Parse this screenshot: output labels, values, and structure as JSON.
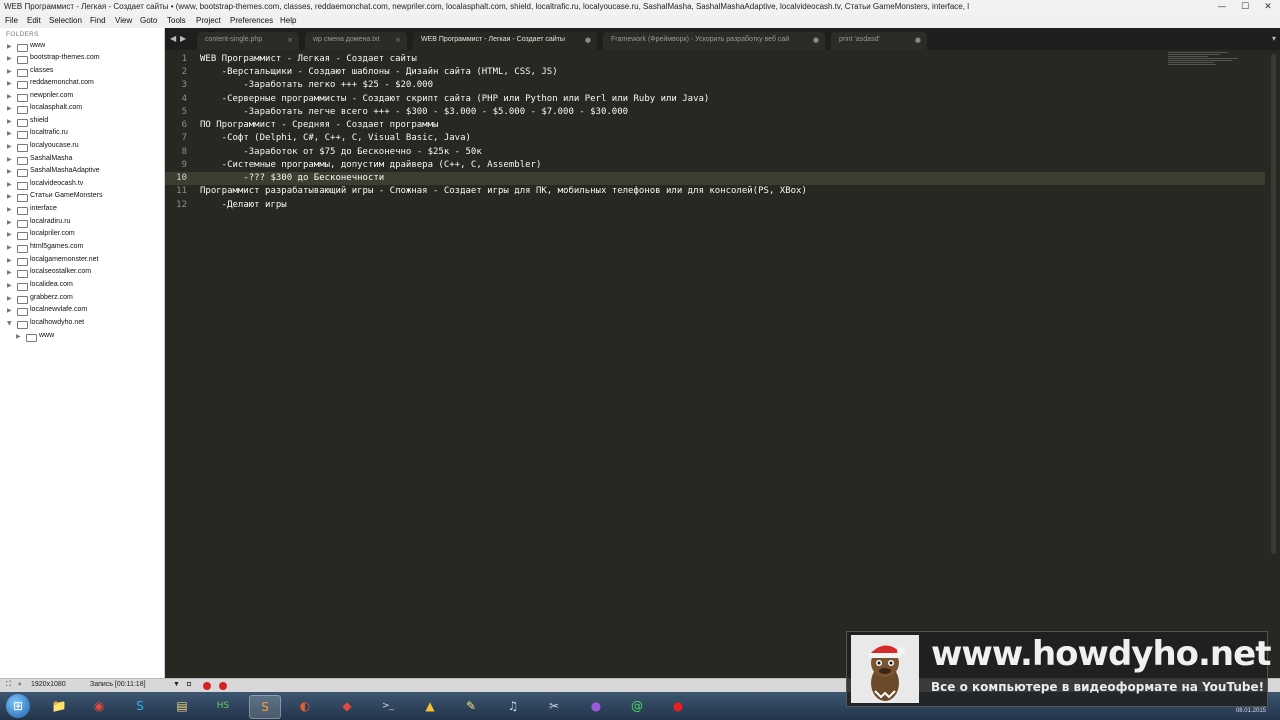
{
  "window": {
    "title": "WEB Программист - Легкая - Создает сайты • (www, bootstrap-themes.com, classes, reddaemonchat.com, newpriler.com, localasphalt.com, shield, localtrafic.ru, localyoucase.ru, SashalMasha, SashalMashaAdaptive, localvideocash.tv, Статьи GameMonsters, interface, l"
  },
  "menu": [
    "File",
    "Edit",
    "Selection",
    "Find",
    "View",
    "Goto",
    "Tools",
    "Project",
    "Preferences",
    "Help"
  ],
  "sidebar": {
    "header": "FOLDERS",
    "items": [
      {
        "label": "www"
      },
      {
        "label": "bootstrap-themes.com"
      },
      {
        "label": "classes"
      },
      {
        "label": "reddaemonchat.com"
      },
      {
        "label": "newpriler.com"
      },
      {
        "label": "localasphalt.com"
      },
      {
        "label": "shield"
      },
      {
        "label": "localtrafic.ru"
      },
      {
        "label": "localyoucase.ru"
      },
      {
        "label": "SashalMasha"
      },
      {
        "label": "SashalMashaAdaptive"
      },
      {
        "label": "localvideocash.tv"
      },
      {
        "label": "Статьи GameMonsters"
      },
      {
        "label": "interface"
      },
      {
        "label": "localradiru.ru"
      },
      {
        "label": "localpriler.com"
      },
      {
        "label": "html5games.com"
      },
      {
        "label": "localgamemonster.net"
      },
      {
        "label": "localseostalker.com"
      },
      {
        "label": "localidea.com"
      },
      {
        "label": "grabberz.com"
      },
      {
        "label": "localnewvlafe.com"
      },
      {
        "label": "localhowdyho.net"
      }
    ],
    "child": {
      "label": "www"
    }
  },
  "tabs": [
    {
      "label": "content-single.php",
      "close": "×"
    },
    {
      "label": "wp смена домена.txt",
      "close": "×"
    },
    {
      "label": "WEB Программист - Легкая - Создает сайты",
      "close": "●"
    },
    {
      "label": "Framework (Фреймворк) - Ускорить разработку веб сай",
      "close": "●"
    },
    {
      "label": "print 'asdasd'",
      "close": "●"
    }
  ],
  "editor": {
    "current_line": 10,
    "lines": [
      {
        "num": "1",
        "text": "WEB Программист - Легкая - Создает сайты"
      },
      {
        "num": "2",
        "text": "    -Верстальщики - Создают шаблоны - Дизайн сайта (HTML, CSS, JS)"
      },
      {
        "num": "3",
        "text": "        -Заработать легко +++ $25 - $20.000"
      },
      {
        "num": "4",
        "text": "    -Серверные программисты - Создают скрипт сайта (PHP или Python или Perl или Ruby или Java)"
      },
      {
        "num": "5",
        "text": "        -Заработать легче всего +++ - $300 - $3.000 - $5.000 - $7.000 - $30.000"
      },
      {
        "num": "6",
        "text": "ПО Программист - Средняя - Создает программы"
      },
      {
        "num": "7",
        "text": "    -Софт (Delphi, C#, C++, C, Visual Basic, Java)"
      },
      {
        "num": "8",
        "text": "        -Заработок от $75 до Бесконечно - $25к - 50к"
      },
      {
        "num": "9",
        "text": "    -Системные программы, допустим драйвера (C++, C, Assembler)"
      },
      {
        "num": "10",
        "text": "        -??? $300 до Бесконечности"
      },
      {
        "num": "11",
        "text": "Программист разрабатывающий игры - Сложная - Создает игры для ПК, мобильных телефонов или для консолей(PS, XBox)"
      },
      {
        "num": "12",
        "text": "    -Делают игры"
      }
    ]
  },
  "status": {
    "resolution": "1920x1080",
    "recording": "Запись [00:11:18]"
  },
  "taskbar": {
    "clock": "08.01.2015",
    "apps": [
      {
        "icon": "explorer-icon",
        "glyph": "📁"
      },
      {
        "icon": "chrome-icon",
        "glyph": "◉"
      },
      {
        "icon": "skype-icon",
        "glyph": "S"
      },
      {
        "icon": "folder-icon",
        "glyph": "▤"
      },
      {
        "icon": "hs-icon",
        "glyph": "HS"
      },
      {
        "icon": "sublime-icon",
        "glyph": "S"
      },
      {
        "icon": "opera-icon",
        "glyph": "◐"
      },
      {
        "icon": "git-icon",
        "glyph": "◆"
      },
      {
        "icon": "terminal-icon",
        "glyph": ">_"
      },
      {
        "icon": "warning-icon",
        "glyph": "▲"
      },
      {
        "icon": "notes-icon",
        "glyph": "✎"
      },
      {
        "icon": "music-icon",
        "glyph": "♫"
      },
      {
        "icon": "tool-icon",
        "glyph": "✂"
      },
      {
        "icon": "media-icon",
        "glyph": "●"
      },
      {
        "icon": "mail-icon",
        "glyph": "@"
      },
      {
        "icon": "record-icon",
        "glyph": "●"
      }
    ]
  },
  "watermark": {
    "site": "www.howdyho.net",
    "tagline": "Все о компьютере в видеоформате на YouTube!"
  },
  "colors": {
    "editor_bg": "#272822",
    "editor_text": "#f8f8f2",
    "line_highlight": "#3e3d32",
    "gutter_text": "#8f908a",
    "sidebar_bg": "#ffffff"
  }
}
